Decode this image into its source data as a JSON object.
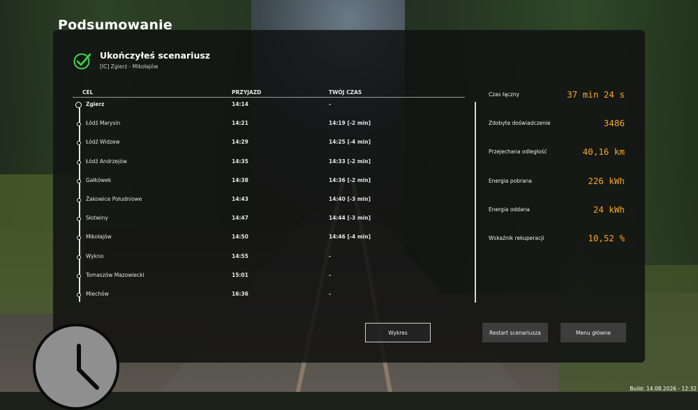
{
  "header": {
    "title": "Podsumowanie"
  },
  "summary": {
    "status": "Ukończyłeś scenariusz",
    "route": "[IC] Zgierz - Mikołajów"
  },
  "table": {
    "columns": [
      "CEL",
      "PRZYJAZD",
      "TWÓJ CZAS"
    ],
    "rows": [
      {
        "stop": "Zgierz",
        "arrival": "14:14",
        "your_time": "-"
      },
      {
        "stop": "Łódź Marysin",
        "arrival": "14:21",
        "your_time": "14:19 [-2 min]"
      },
      {
        "stop": "Łódź Widzew",
        "arrival": "14:29",
        "your_time": "14:25 [-4 min]"
      },
      {
        "stop": "Łódź Andrzejów",
        "arrival": "14:35",
        "your_time": "14:33 [-2 min]"
      },
      {
        "stop": "Gałkówek",
        "arrival": "14:38",
        "your_time": "14:36 [-2 min]"
      },
      {
        "stop": "Żakowice Południowe",
        "arrival": "14:43",
        "your_time": "14:40 [-3 min]"
      },
      {
        "stop": "Słotwiny",
        "arrival": "14:47",
        "your_time": "14:44 [-3 min]"
      },
      {
        "stop": "Mikołajów",
        "arrival": "14:50",
        "your_time": "14:46 [-4 min]"
      },
      {
        "stop": "Wykno",
        "arrival": "14:55",
        "your_time": "-"
      },
      {
        "stop": "Tomaszów Mazowiecki",
        "arrival": "15:01",
        "your_time": "-"
      },
      {
        "stop": "Miechów",
        "arrival": "16:36",
        "your_time": "-"
      }
    ]
  },
  "stats": [
    {
      "label": "Czas łączny",
      "value": "37 min 24 s"
    },
    {
      "label": "Zdobyte doświadczenie",
      "value": "3486"
    },
    {
      "label": "Przejechana odległość",
      "value": "40,16 km"
    },
    {
      "label": "Energia pobrana",
      "value": "226 kWh"
    },
    {
      "label": "Energia oddana",
      "value": "24 kWh"
    },
    {
      "label": "Wskaźnik rekuperacji",
      "value": "10,52 %"
    }
  ],
  "buttons": {
    "chart": "Wykres",
    "restart": "Restart scenariusza",
    "main_menu": "Menu główne"
  },
  "footer": {
    "build": "Build: 14.08.2026 - 12:32"
  },
  "colors": {
    "accent": "#f5a623",
    "check": "#3ddc4a"
  },
  "icons": {
    "status": "check-icon",
    "clock": "clock-icon"
  }
}
